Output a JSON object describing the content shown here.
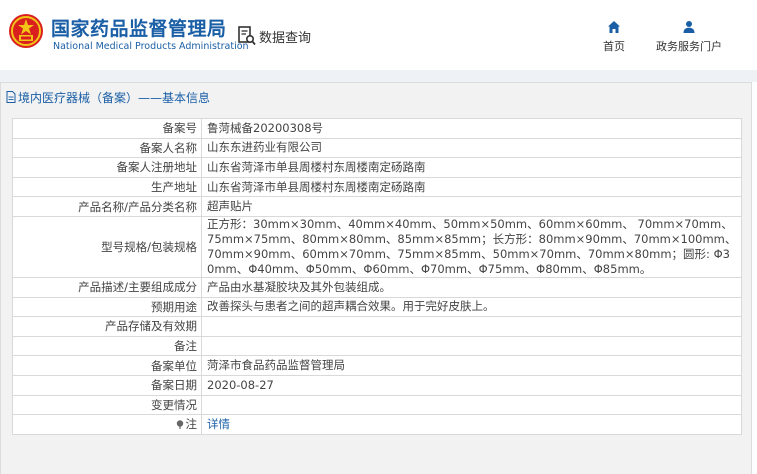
{
  "header": {
    "brand_cn": "国家药品监督管理局",
    "brand_en": "National Medical Products Administration",
    "query_label": "数据查询",
    "nav_home": "首页",
    "nav_portal": "政务服务门户"
  },
  "panel": {
    "title": "境内医疗器械（备案）——基本信息"
  },
  "rows": [
    {
      "label": "备案号",
      "value": "鲁菏械备20200308号"
    },
    {
      "label": "备案人名称",
      "value": "山东东进药业有限公司"
    },
    {
      "label": "备案人注册地址",
      "value": "山东省菏泽市单县周楼村东周楼南定砀路南"
    },
    {
      "label": "生产地址",
      "value": "山东省菏泽市单县周楼村东周楼南定砀路南"
    },
    {
      "label": "产品名称/产品分类名称",
      "value": "超声贴片"
    },
    {
      "label": "型号规格/包装规格",
      "value": "正方形：30mm×30mm、40mm×40mm、50mm×50mm、60mm×60mm、 70mm×70mm、75mm×75mm、80mm×80mm、85mm×85mm；长方形：80mm×90mm、70mm×100mm、70mm×90mm、60mm×70mm、75mm×85mm、50mm×70mm、70mm×80mm；圆形: Φ30mm、Φ40mm、Φ50mm、Φ60mm、Φ70mm、Φ75mm、Φ80mm、Φ85mm。"
    },
    {
      "label": "产品描述/主要组成成分",
      "value": "产品由水基凝胶块及其外包装组成。"
    },
    {
      "label": "预期用途",
      "value": "改善探头与患者之间的超声耦合效果。用于完好皮肤上。"
    },
    {
      "label": "产品存储及有效期",
      "value": ""
    },
    {
      "label": "备注",
      "value": ""
    },
    {
      "label": "备案单位",
      "value": "菏泽市食品药品监督管理局"
    },
    {
      "label": "备案日期",
      "value": "2020-08-27"
    },
    {
      "label": "变更情况",
      "value": ""
    },
    {
      "label": "注",
      "value": "详情"
    }
  ],
  "colors": {
    "brand_blue": "#1a5fa6",
    "emblem_red": "#d9201f",
    "emblem_gold": "#f2c418",
    "panel_bg": "#f2f2f2",
    "border": "#d9d9d9"
  },
  "icons": {
    "emblem": "national-emblem-icon",
    "query": "document-search-icon",
    "home": "home-icon",
    "portal": "user-icon",
    "title": "document-icon",
    "note": "pin-icon"
  }
}
